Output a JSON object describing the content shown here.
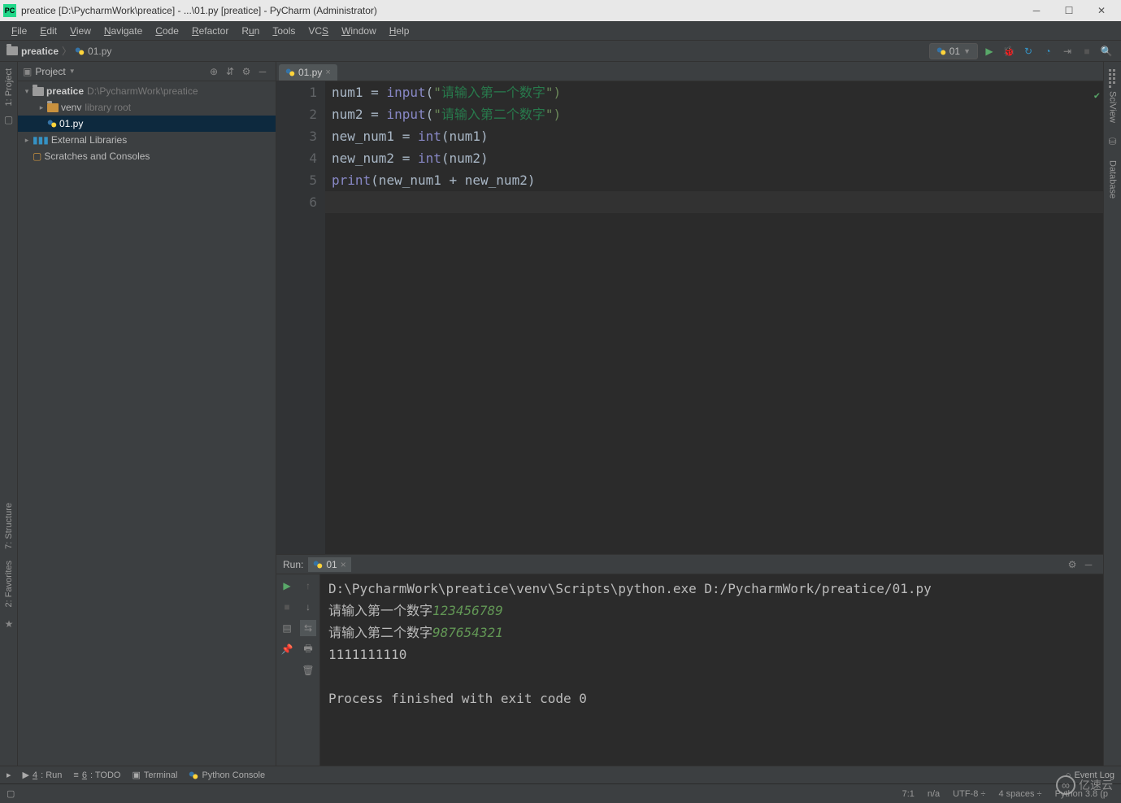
{
  "window": {
    "title": "preatice [D:\\PycharmWork\\preatice] - ...\\01.py [preatice] - PyCharm (Administrator)",
    "app_badge": "PC"
  },
  "menu": [
    "File",
    "Edit",
    "View",
    "Navigate",
    "Code",
    "Refactor",
    "Run",
    "Tools",
    "VCS",
    "Window",
    "Help"
  ],
  "breadcrumb": {
    "root": "preatice",
    "file": "01.py"
  },
  "run_config": {
    "name": "01"
  },
  "project_header": {
    "label": "Project"
  },
  "tree": {
    "root": {
      "name": "preatice",
      "path": "D:\\PycharmWork\\preatice"
    },
    "venv": {
      "name": "venv",
      "note": "library root"
    },
    "file": {
      "name": "01.py"
    },
    "ext": {
      "name": "External Libraries"
    },
    "scratch": {
      "name": "Scratches and Consoles"
    }
  },
  "editor_tab": {
    "name": "01.py"
  },
  "code": {
    "l1": {
      "var": "num1",
      "eq": " = ",
      "fn": "input",
      "paren": "(",
      "q": "\"",
      "zh": "请输入第一个数字",
      "end": "\")"
    },
    "l2": {
      "var": "num2",
      "eq": " = ",
      "fn": "input",
      "paren": "(",
      "q": "\"",
      "zh": "请输入第二个数字",
      "end": "\")"
    },
    "l3": {
      "var": "new_num1",
      "eq": " = ",
      "fn": "int",
      "args": "(num1)"
    },
    "l4": {
      "var": "new_num2",
      "eq": " = ",
      "fn": "int",
      "args": "(num2)"
    },
    "l5": {
      "fn": "print",
      "args": "(new_num1 + new_num2)"
    }
  },
  "line_numbers": [
    "1",
    "2",
    "3",
    "4",
    "5",
    "6"
  ],
  "run_panel": {
    "label": "Run:",
    "tab": "01",
    "cmd": "D:\\PycharmWork\\preatice\\venv\\Scripts\\python.exe D:/PycharmWork/preatice/01.py",
    "prompt1": "请输入第一个数字",
    "in1": "123456789",
    "prompt2": "请输入第二个数字",
    "in2": "987654321",
    "result": "1111111110",
    "exit": "Process finished with exit code 0"
  },
  "side_left": {
    "project": "1: Project",
    "structure": "7: Structure",
    "favorites": "2: Favorites"
  },
  "side_right": {
    "sci": "SciView",
    "db": "Database"
  },
  "bottom_tabs": {
    "run": "4: Run",
    "todo": "6: TODO",
    "terminal": "Terminal",
    "pyconsole": "Python Console",
    "eventlog": "Event Log"
  },
  "status": {
    "pos": "7:1",
    "na": "n/a",
    "enc": "UTF-8",
    "indent": "4 spaces",
    "py": "Python 3.8 (p"
  },
  "watermark": "亿速云"
}
